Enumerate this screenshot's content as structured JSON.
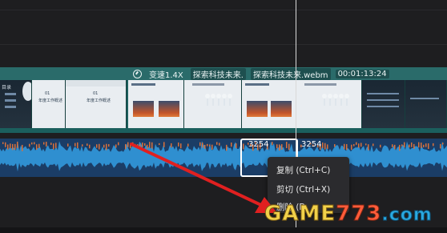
{
  "video_clip": {
    "speed_label": "变速1.4X",
    "name_1": "探索科技未来.",
    "name_2": "探索科技未来.webm",
    "duration": "00:01:13:24"
  },
  "thumbnails": {
    "slide_a_label": "目录",
    "slide_b_number": "01",
    "slide_b_title": "年度工作概述",
    "slide_c_number": "01",
    "slide_c_title": "年度工作概述"
  },
  "audio_clip": {
    "marker_left": "3254",
    "marker_right": "3254"
  },
  "context_menu": {
    "copy": "复制 (Ctrl+C)",
    "cut": "剪切 (Ctrl+X)",
    "delete": "删除 (D"
  },
  "watermark": {
    "part1": "GAME",
    "part2": "773",
    "part3": ".com"
  },
  "colors": {
    "video_track": "#1b5f5d",
    "audio_track": "#1b3d66",
    "waveform": "#2f8fd0",
    "arrow": "#e02020"
  }
}
